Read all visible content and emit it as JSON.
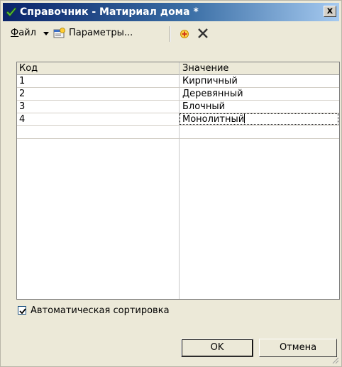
{
  "window": {
    "title": "Справочник - Матириал дома *",
    "close_label": "x",
    "icon": "check-leaf-icon"
  },
  "toolbar": {
    "file_label_prefix": "Ф",
    "file_label_rest": "айл",
    "params_label": "Параметры...",
    "icons": [
      "dropdown-arrow-icon",
      "parameters-icon",
      "add-record-icon",
      "delete-record-icon"
    ]
  },
  "grid": {
    "columns": [
      "Код",
      "Значение"
    ],
    "rows": [
      {
        "code": "1",
        "value": "Кирпичный"
      },
      {
        "code": "2",
        "value": "Деревянный"
      },
      {
        "code": "3",
        "value": "Блочный"
      },
      {
        "code": "4",
        "value": "Монолитный"
      }
    ],
    "selected_row": 4
  },
  "options": {
    "auto_sort_label": "Автоматическая сортировка",
    "auto_sort_checked": true
  },
  "buttons": {
    "ok": "OK",
    "cancel": "Отмена"
  }
}
